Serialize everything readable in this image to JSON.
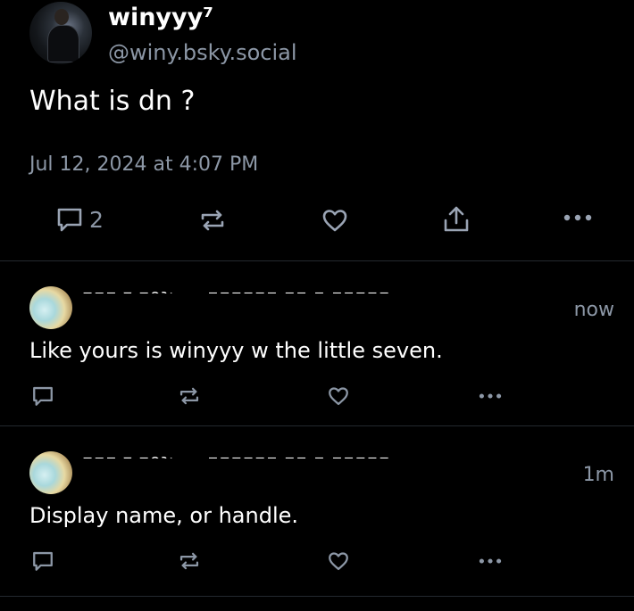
{
  "post": {
    "author_name": "winyyy⁷",
    "author_handle": "@winy.bsky.social",
    "text": "What is dn ?",
    "timestamp": "Jul 12, 2024 at 4:07 PM",
    "reply_count": "2"
  },
  "replies": [
    {
      "name_obscured": "▪▫▪ ▾ ▪ɘɿ▸ ▬ ▪▪▪▪▪▪ ▪▪ ▪ ▪▪▪▪▪",
      "age": "now",
      "text": "Like yours is winyyy w the little seven."
    },
    {
      "name_obscured": "▪▫▪ ▾ ▪ɘɿ▸ ▬ ▪▪▪▪▪▪ ▪▪ ▪ ▪▪▪▪▪",
      "age": "1m",
      "text": "Display name, or handle."
    }
  ],
  "colors": {
    "background": "#000000",
    "text_primary": "#ffffff",
    "text_secondary": "#8c97a6",
    "icon_main": "#9aa4b4",
    "accent": "#1185fe",
    "divider": "#24292f"
  },
  "icons": {
    "reply": "speech-bubble-icon",
    "repost": "repost-arrows-icon",
    "like": "heart-icon",
    "share": "share-icon",
    "more": "more-dots-icon"
  }
}
